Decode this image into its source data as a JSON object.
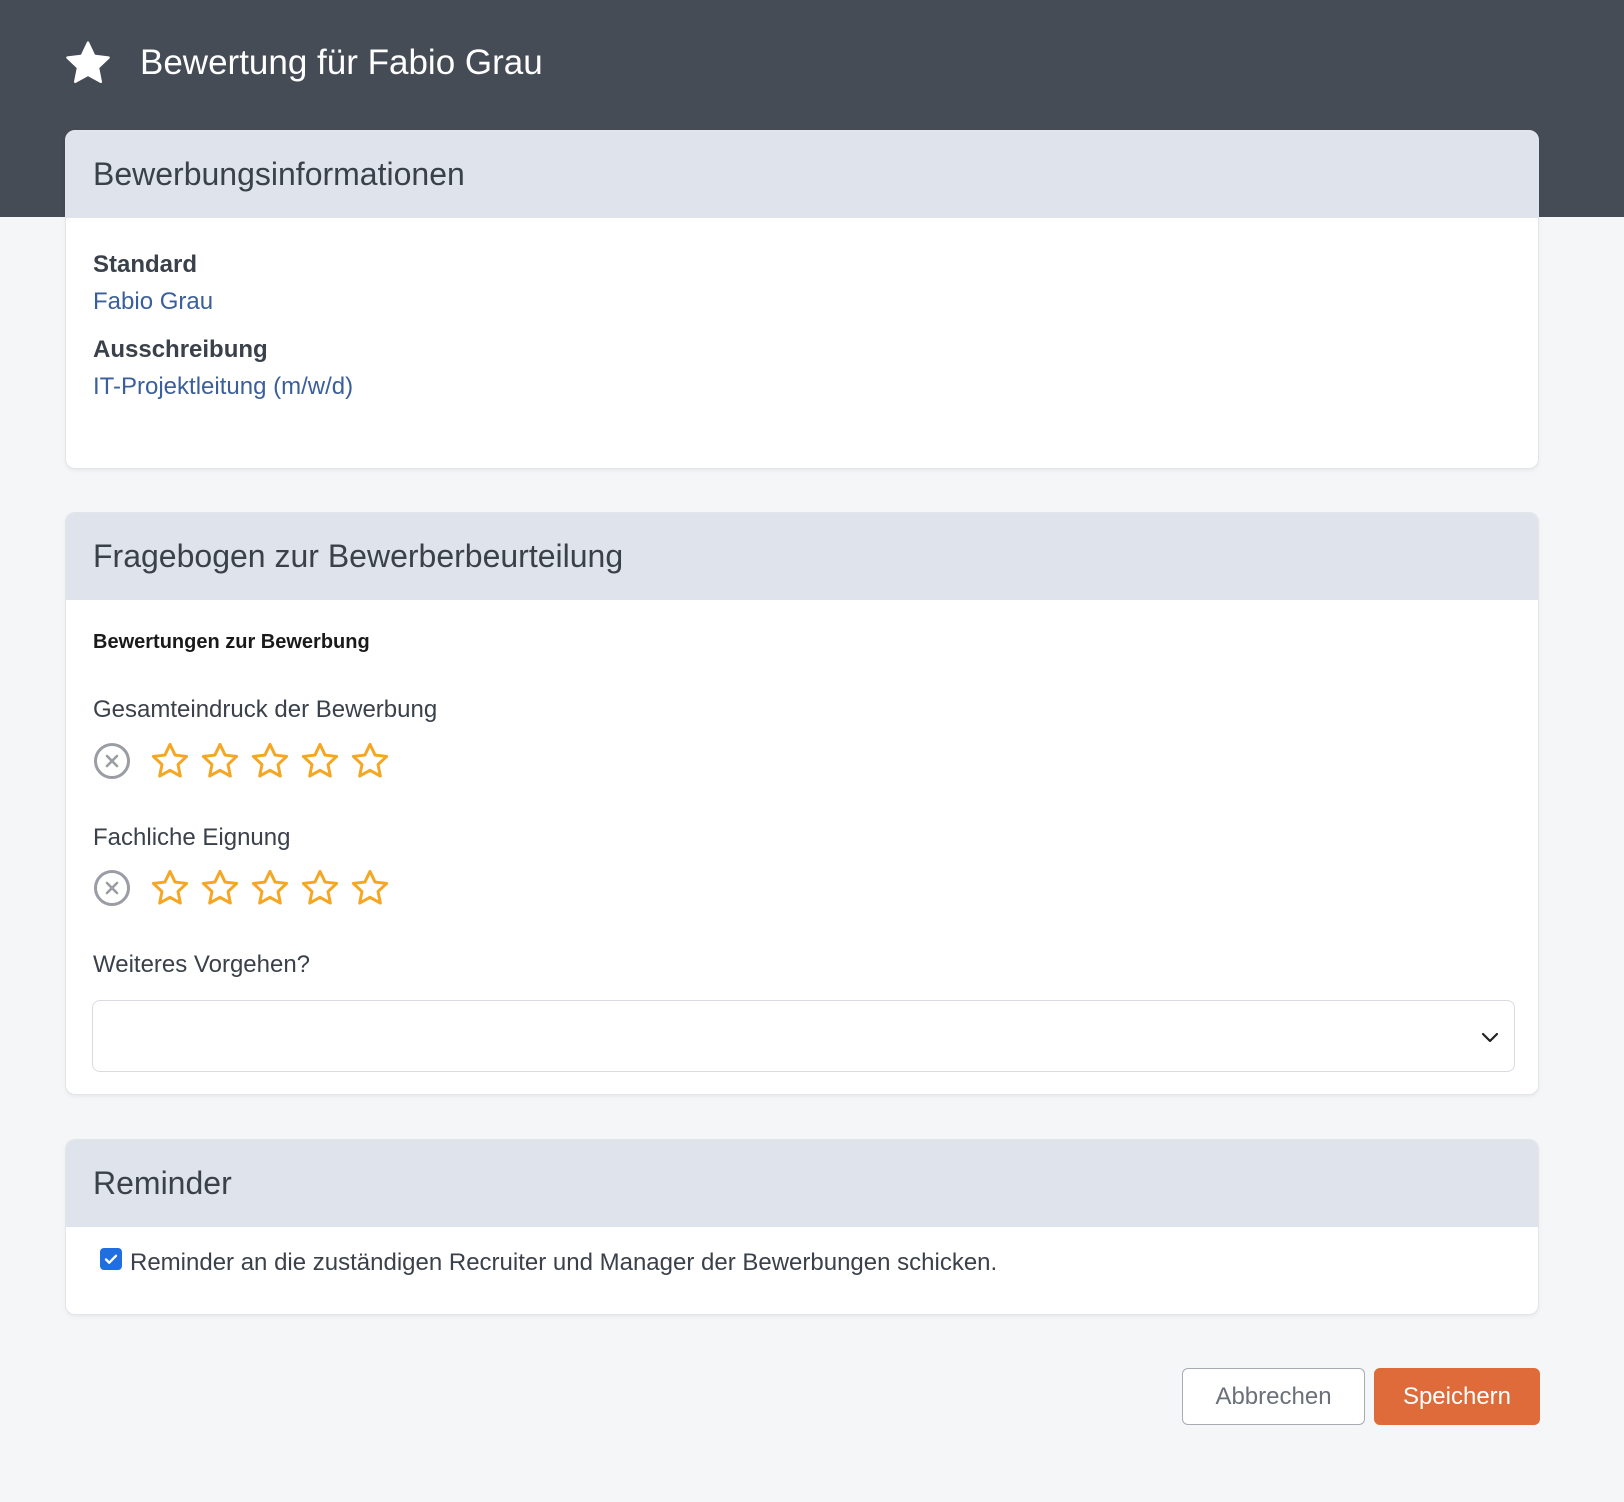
{
  "header": {
    "title": "Bewertung für Fabio Grau",
    "icon": "star-icon"
  },
  "info_card": {
    "title": "Bewerbungsinformationen",
    "fields": [
      {
        "label": "Standard",
        "value": "Fabio Grau"
      },
      {
        "label": "Ausschreibung",
        "value": "IT-Projektleitung (m/w/d)"
      }
    ]
  },
  "form_card": {
    "title": "Fragebogen zur Bewerberbeurteilung",
    "section_title": "Bewertungen zur Bewerbung",
    "ratings": [
      {
        "label": "Gesamteindruck der Bewerbung",
        "value": 0,
        "max": 5
      },
      {
        "label": "Fachliche Eignung",
        "value": 0,
        "max": 5
      }
    ],
    "next_step": {
      "label": "Weiteres Vorgehen?",
      "selected": ""
    }
  },
  "reminder_card": {
    "title": "Reminder",
    "checkbox_checked": true,
    "checkbox_label": "Reminder an die zuständigen Recruiter und Manager der Bewerbungen schicken."
  },
  "actions": {
    "cancel_label": "Abbrechen",
    "save_label": "Speichern"
  },
  "colors": {
    "header_bg": "#454c56",
    "card_header_bg": "#dfe3eb",
    "link": "#3a5f9a",
    "star": "#f5a623",
    "primary": "#de6b39",
    "checkbox": "#1f6fe0"
  }
}
